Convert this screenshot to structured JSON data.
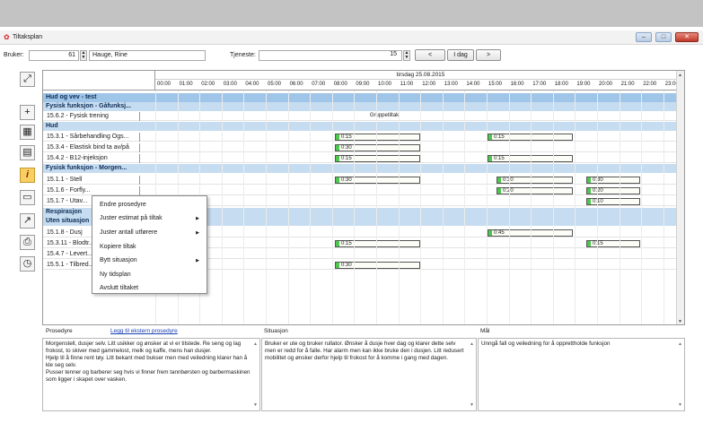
{
  "window": {
    "title": "Tiltaksplan",
    "buttons": [
      "minimize",
      "maximize",
      "close"
    ]
  },
  "toolbar": {
    "user_label": "Bruker:",
    "user_id": "61",
    "user_name": "Hauge, Rine",
    "service_label": "Tjeneste:",
    "service_value": "",
    "zoom_value": "15",
    "prev_label": "<",
    "today_label": "I dag",
    "next_label": ">"
  },
  "grid": {
    "date": "tirsdag 25.08.2015",
    "hours": [
      "00:00",
      "01:00",
      "02:00",
      "03:00",
      "04:00",
      "05:00",
      "06:00",
      "07:00",
      "08:00",
      "09:00",
      "10:00",
      "11:00",
      "12:00",
      "13:00",
      "14:00",
      "15:00",
      "16:00",
      "17:00",
      "18:00",
      "19:00",
      "20:00",
      "21:00",
      "22:00",
      "23:00"
    ],
    "rows": [
      {
        "type": "group",
        "name": "Hud og vev - test"
      },
      {
        "type": "sub",
        "name": "Fysisk funksjon - Gåfunksj..."
      },
      {
        "type": "item",
        "name": "15.6.2 - Fysisk trening",
        "bars": [
          {
            "text": "Gruppetiltak",
            "plain": true
          }
        ]
      },
      {
        "type": "sub",
        "name": "Hud"
      },
      {
        "type": "item",
        "name": "15.3.1 - Sårbehandling Ogs...",
        "bars": [
          {
            "text": "0:15"
          },
          {
            "text": "0:15"
          }
        ]
      },
      {
        "type": "item",
        "name": "15.3.4 - Elastisk bind ta av/på",
        "bars": [
          {
            "text": "0:30"
          }
        ]
      },
      {
        "type": "item",
        "name": "15.4.2 - B12-injeksjon",
        "bars": [
          {
            "text": "0:15"
          },
          {
            "text": "0:15"
          }
        ]
      },
      {
        "type": "sub",
        "name": "Fysisk funksjon - Morgen..."
      },
      {
        "type": "item",
        "name": "15.1.1 - Stell",
        "bars": [
          {
            "text": "0:30"
          },
          {
            "text": "0:30"
          },
          {
            "text": "0:30"
          }
        ]
      },
      {
        "type": "item",
        "name": "15.1.6 - Forfly...",
        "bars": [
          {
            "text": "0:20"
          },
          {
            "text": "0:20"
          }
        ]
      },
      {
        "type": "item",
        "name": "15.1.7 - Utav...",
        "bars": [
          {
            "text": "0:10"
          }
        ]
      },
      {
        "type": "sub",
        "name": "Respirasjon"
      },
      {
        "type": "sub",
        "name": "Uten situasjon"
      },
      {
        "type": "item",
        "name": "15.1.8 - Dusj",
        "bars": [
          {
            "text": "0:45"
          }
        ]
      },
      {
        "type": "item",
        "name": "15.3.11 - Blodtr...",
        "bars": [
          {
            "text": "0:15"
          },
          {
            "text": "0:15"
          }
        ]
      },
      {
        "type": "item",
        "name": "15.4.7 - Levert...",
        "bars": []
      },
      {
        "type": "item",
        "name": "15.5.1 - Tilbred...",
        "bars": [
          {
            "text": "0:30"
          }
        ]
      }
    ]
  },
  "context_menu": {
    "items": [
      {
        "label": "Endre prosedyre",
        "submenu": false
      },
      {
        "label": "Juster estimat på tiltak",
        "submenu": true
      },
      {
        "label": "Juster antall utførere",
        "submenu": true
      },
      {
        "label": "Kopiere tiltak",
        "submenu": false
      },
      {
        "label": "Bytt situasjon",
        "submenu": true
      },
      {
        "label": "Ny tidsplan",
        "submenu": false
      },
      {
        "label": "Avslutt tiltaket",
        "submenu": false
      }
    ]
  },
  "panels": {
    "procedure_label": "Prosedyre",
    "procedure_link": "Legg til ekstern prosedyre",
    "procedure_text": "Morgenstell, dusjer selv. Litt usikker og ønsker at vi er tilstede. Re seng og lag frokost, to skiver med gammelost, melk og kaffe, mens han dusjer.\nHjelp til å finne rent tøy. Litt bekant med bukser men med veiledning klarer han å kle seg selv.\nPusser tenner og barberer seg hvis vi finner frem tannbørsten og barbermaskinen som ligger i skapet over vasken.",
    "situation_label": "Situasjon",
    "situation_text": "Bruker er ute og bruker rullator. Ønsker å dusje hver dag og klarer dette selv men er redd for å falle. Har alarm men kan ikke bruke den i dusjen. Litt redusert mobilitet og ønsker derfor hjelp til frokost for å komme i gang med dagen.",
    "goal_label": "Mål",
    "goal_text": "Unngå fall og veiledning for å opprettholde funksjon"
  }
}
